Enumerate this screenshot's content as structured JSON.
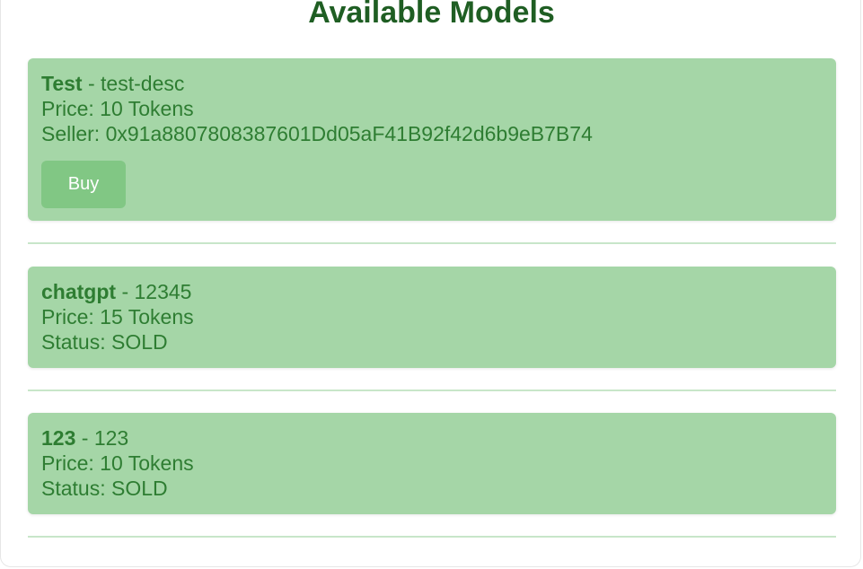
{
  "header": {
    "title": "Available Models"
  },
  "models": [
    {
      "name": "Test",
      "separator": " - ",
      "description": "test-desc",
      "price_text": "Price: 10 Tokens",
      "seller_text": "Seller: 0x91a8807808387601Dd05aF41B92f42d6b9eB7B74",
      "buy_label": "Buy"
    },
    {
      "name": "chatgpt",
      "separator": " - ",
      "description": "12345",
      "price_text": "Price: 15 Tokens",
      "status_text": "Status: SOLD"
    },
    {
      "name": "123",
      "separator": " - ",
      "description": "123",
      "price_text": "Price: 10 Tokens",
      "status_text": "Status: SOLD"
    }
  ],
  "colors": {
    "title": "#1f5e23",
    "card_background": "#a5d6a7",
    "card_text": "#2e7d32",
    "buy_button": "#81c784",
    "divider": "#c8e6c9"
  }
}
